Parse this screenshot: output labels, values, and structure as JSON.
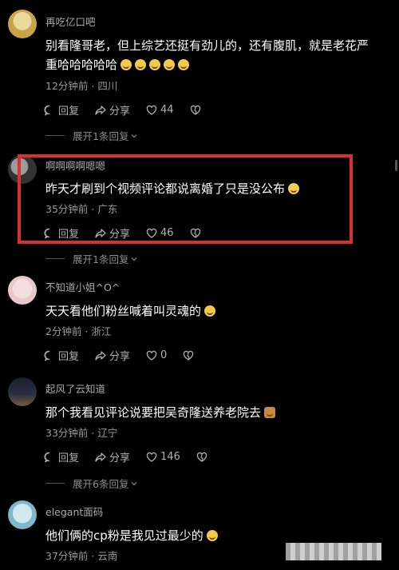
{
  "comments": [
    {
      "username": "再吃亿口吧",
      "text": "别看隆哥老，但上综艺还挺有劲儿的，还有腹肌，就是老花严",
      "text2": "重哈哈哈哈哈",
      "emoji_count": 5,
      "time": "12分钟前",
      "location": "四川",
      "reply_label": "回复",
      "share_label": "分享",
      "likes": "44",
      "expand_label": "展开1条回复"
    },
    {
      "username": "啊啊啊啊嗯嗯",
      "text": "昨天才刷到个视频评论都说离婚了只是没公布",
      "emoji": "laugh-cry",
      "time": "35分钟前",
      "location": "广东",
      "reply_label": "回复",
      "share_label": "分享",
      "likes": "46",
      "expand_label": "展开1条回复"
    },
    {
      "username": "不知道小姐^O^",
      "text": "天天看他们粉丝喊着叫灵魂的",
      "emoji": "grin",
      "time": "2分钟前",
      "location": "浙江",
      "reply_label": "回复",
      "share_label": "分享",
      "likes": "0"
    },
    {
      "username": "起风了云知道",
      "text": "那个我看见评论说要把吴奇隆送养老院去",
      "emoji": "cat",
      "time": "33分钟前",
      "location": "辽宁",
      "reply_label": "回复",
      "share_label": "分享",
      "likes": "146",
      "expand_label": "展开6条回复"
    },
    {
      "username": "elegant面码",
      "text": "他们俩的cp粉是我见过最少的",
      "emoji": "grin",
      "time": "37分钟前",
      "location": "云南"
    }
  ],
  "meta_separator": " · ",
  "highlight_color": "#d8302f"
}
